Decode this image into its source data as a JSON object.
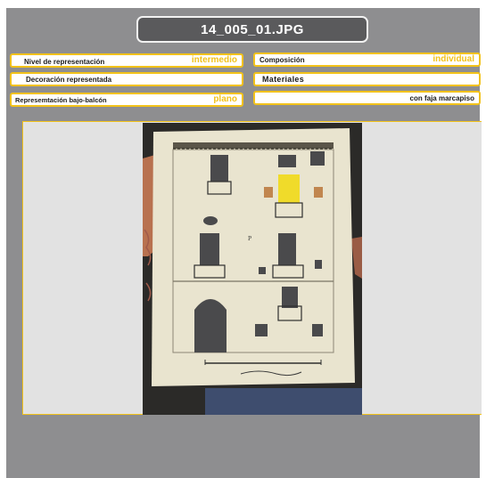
{
  "title": "14_005_01.JPG",
  "fields": {
    "nivel_label": "Nivel de representación",
    "nivel_value": "intermedio",
    "composicion_label": "Composición",
    "composicion_value": "individual",
    "decoracion_label": "Decoración representada",
    "materiales_label": "Materiales",
    "bajo_balcon_label": "Represemtación bajo-balcón",
    "bajo_balcon_value": "plano",
    "faja_label": "con faja marcapiso"
  },
  "colors": {
    "panel": "#8e8e90",
    "accent": "#f2c21a",
    "title_bg": "#5a5a5c"
  }
}
